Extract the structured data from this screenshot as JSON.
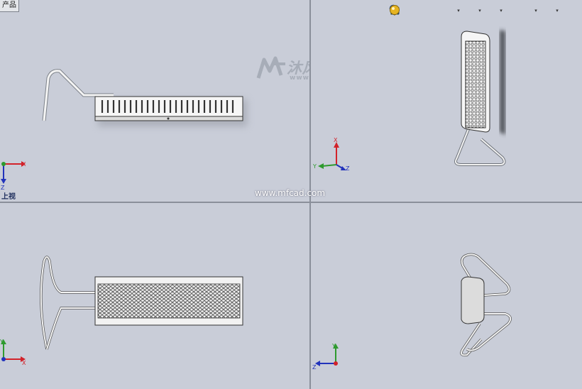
{
  "product_tab": "产品",
  "views": {
    "top_left_label": "上视"
  },
  "watermark": {
    "name": "沐风CAD",
    "url": "www.mfcad.com"
  },
  "site_url": "www.mfcad.com",
  "toolbar": {
    "icons": [
      "zoom-to-fit-icon",
      "zoom-area-icon",
      "previous-view-icon",
      "section-view-icon",
      "view-orientation-icon",
      "display-style-icon",
      "hide-show-items-icon",
      "edit-appearance-icon",
      "apply-scene-icon",
      "view-settings-icon"
    ]
  },
  "axes": {
    "x": "X",
    "y": "Y",
    "z": "Z"
  },
  "colors": {
    "viewport_bg": "#c9cdd8",
    "axis_x": "#d2222a",
    "axis_y": "#2e9a2e",
    "axis_z": "#2233bb"
  }
}
